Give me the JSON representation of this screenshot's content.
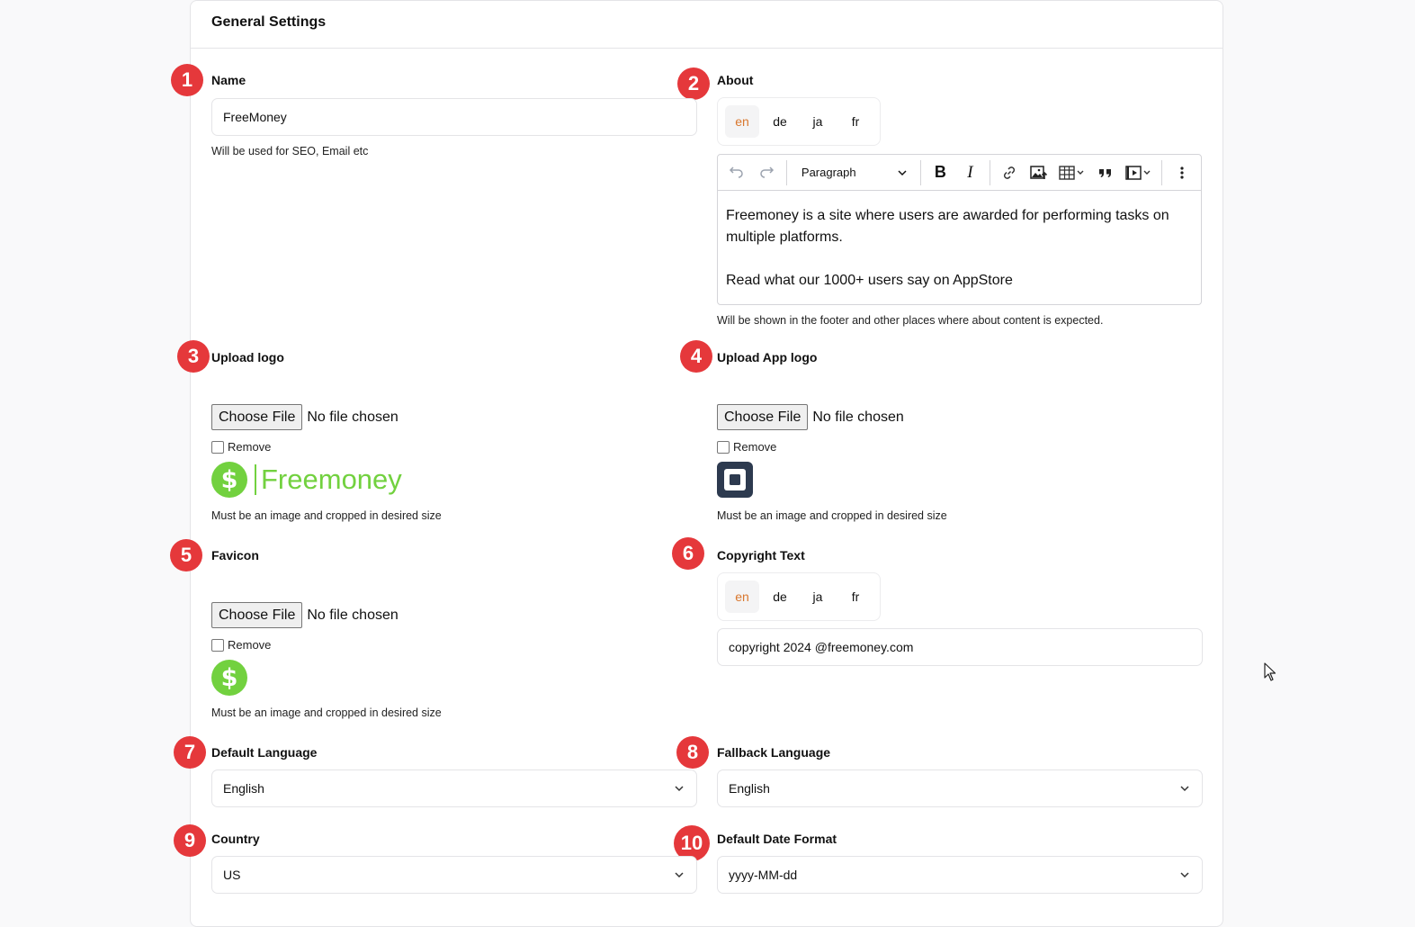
{
  "header": {
    "title": "General Settings"
  },
  "badges": [
    "1",
    "2",
    "3",
    "4",
    "5",
    "6",
    "7",
    "8",
    "9",
    "10"
  ],
  "name": {
    "label": "Name",
    "value": "FreeMoney",
    "hint": "Will be used for SEO, Email etc"
  },
  "about": {
    "label": "About",
    "langs": [
      "en",
      "de",
      "ja",
      "fr"
    ],
    "toolbar": {
      "paragraph": "Paragraph"
    },
    "content": [
      "Freemoney is a site where users are awarded for performing tasks on multiple platforms.",
      "Read what our 1000+ users say on AppStore"
    ],
    "hint": "Will be shown in the footer and other places where about content is expected."
  },
  "upload_logo": {
    "label": "Upload logo",
    "button": "Choose File",
    "status": "No file chosen",
    "remove": "Remove",
    "logo_text": "Freemoney",
    "hint": "Must be an image and cropped in desired size"
  },
  "upload_app_logo": {
    "label": "Upload App logo",
    "button": "Choose File",
    "status": "No file chosen",
    "remove": "Remove",
    "hint": "Must be an image and cropped in desired size"
  },
  "favicon": {
    "label": "Favicon",
    "button": "Choose File",
    "status": "No file chosen",
    "remove": "Remove",
    "hint": "Must be an image and cropped in desired size"
  },
  "copyright": {
    "label": "Copyright Text",
    "langs": [
      "en",
      "de",
      "ja",
      "fr"
    ],
    "value": "copyright 2024 @freemoney.com"
  },
  "default_language": {
    "label": "Default Language",
    "value": "English"
  },
  "fallback_language": {
    "label": "Fallback Language",
    "value": "English"
  },
  "country": {
    "label": "Country",
    "value": "US"
  },
  "date_format": {
    "label": "Default Date Format",
    "value": "yyyy-MM-dd"
  },
  "colors": {
    "accent": "#d9772e",
    "badge": "#e5383b",
    "brand_green": "#72d13f",
    "app_logo": "#2d3a4f"
  }
}
